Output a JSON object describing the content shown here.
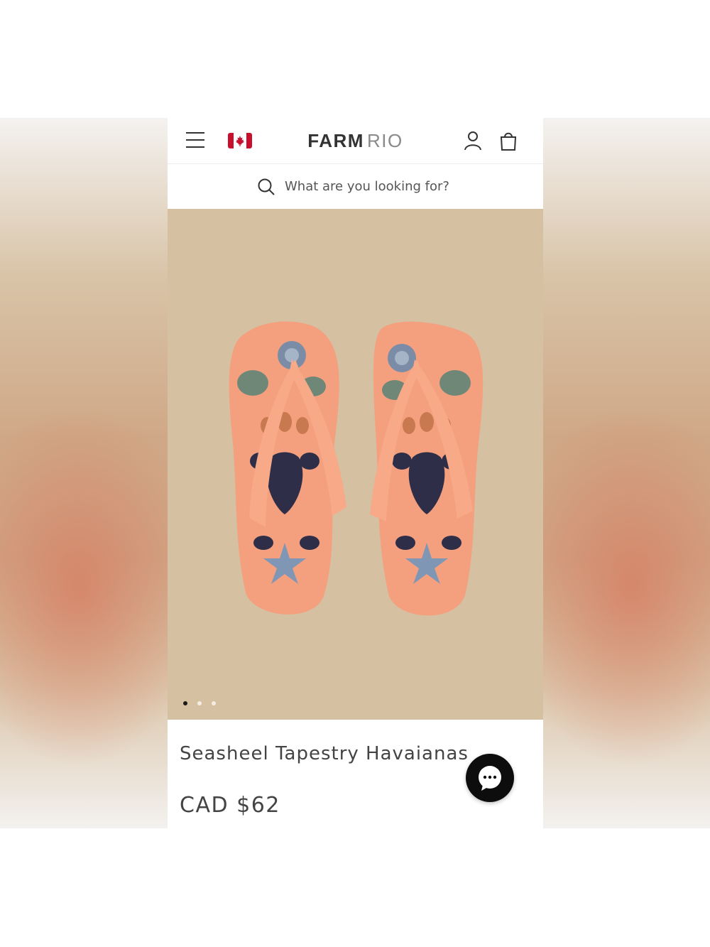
{
  "header": {
    "brand_main": "FARM",
    "brand_sub": "RIO",
    "menu_icon": "hamburger-menu-icon",
    "flag_icon": "canada-flag-icon",
    "account_icon": "user-icon",
    "bag_icon": "shopping-bag-icon"
  },
  "search": {
    "placeholder": "What are you looking for?",
    "icon": "search-icon"
  },
  "gallery": {
    "slide_count": 3,
    "active_index": 0,
    "background": "#d5c0a2",
    "item_color": "#f4a07f"
  },
  "product": {
    "name": "Seasheel Tapestry Havaianas",
    "price": "CAD $62"
  },
  "chat": {
    "icon": "chat-bubble-icon"
  }
}
